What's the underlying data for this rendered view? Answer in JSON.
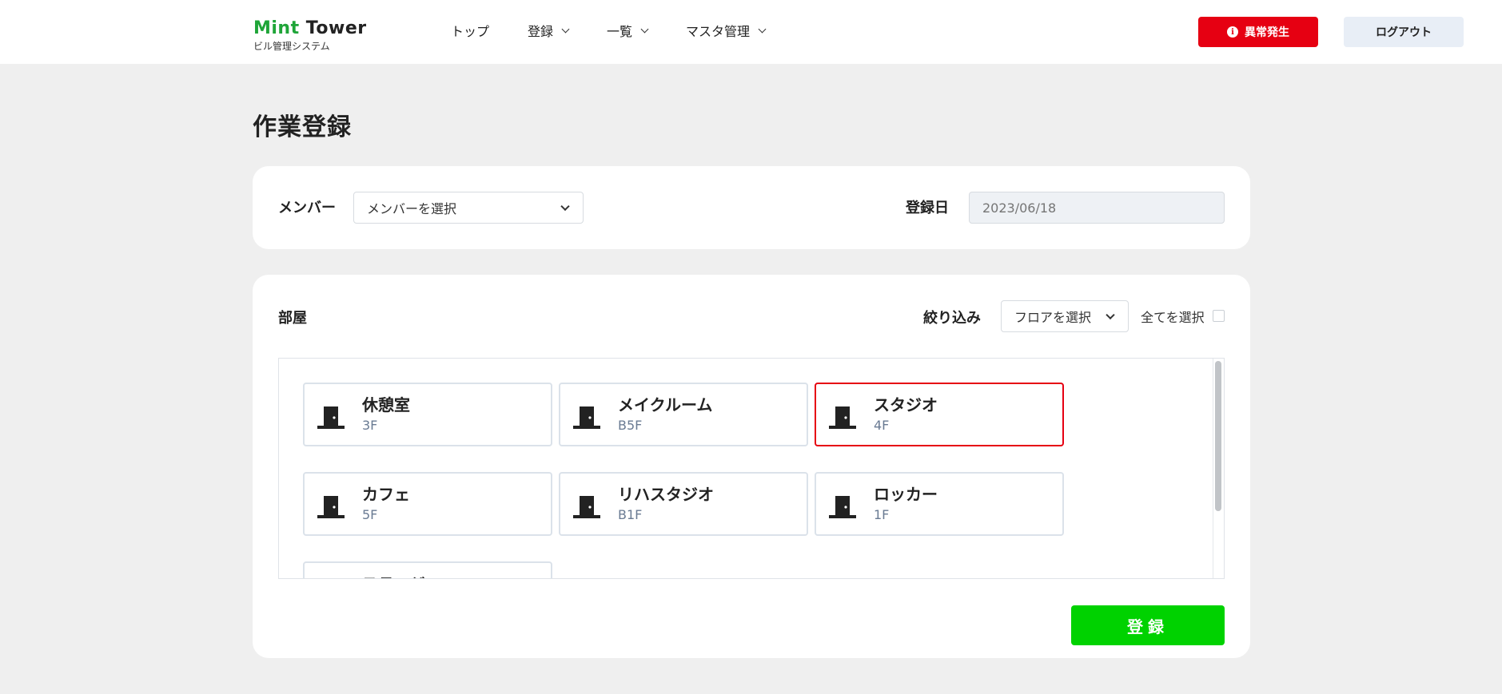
{
  "header": {
    "logo_mint": "Mint",
    "logo_tower": "Tower",
    "logo_sub": "ビル管理システム",
    "nav": [
      {
        "label": "トップ"
      },
      {
        "label": "登録"
      },
      {
        "label": "一覧"
      },
      {
        "label": "マスタ管理"
      }
    ],
    "alert_label": "異常発生",
    "alert_icon_glyph": "i",
    "logout_label": "ログアウト"
  },
  "page": {
    "title": "作業登録"
  },
  "member_card": {
    "member_label": "メンバー",
    "member_select_value": "メンバーを選択",
    "date_label": "登録日",
    "date_placeholder": "2023/06/18"
  },
  "room_card": {
    "title": "部屋",
    "filter_label": "絞り込み",
    "floor_select_value": "フロアを選択",
    "select_all_label": "全てを選択",
    "select_all_checked": false,
    "rooms": [
      {
        "name": "休憩室",
        "floor": "3F",
        "selected": false
      },
      {
        "name": "メイクルーム",
        "floor": "B5F",
        "selected": false
      },
      {
        "name": "スタジオ",
        "floor": "4F",
        "selected": true
      },
      {
        "name": "カフェ",
        "floor": "5F",
        "selected": false
      },
      {
        "name": "リハスタジオ",
        "floor": "B1F",
        "selected": false
      },
      {
        "name": "ロッカー",
        "floor": "1F",
        "selected": false
      },
      {
        "name": "ステージ",
        "floor": "",
        "selected": false
      }
    ],
    "submit_label": "登録"
  },
  "colors": {
    "brand_green": "#1fa538",
    "alert_red": "#e60012",
    "submit_green": "#00d200",
    "selected_border": "#e60012",
    "floor_text": "#6a7b93"
  },
  "icons": {
    "alert": "info-circle-icon",
    "room": "door-icon",
    "dropdown": "chevron-down-icon"
  }
}
